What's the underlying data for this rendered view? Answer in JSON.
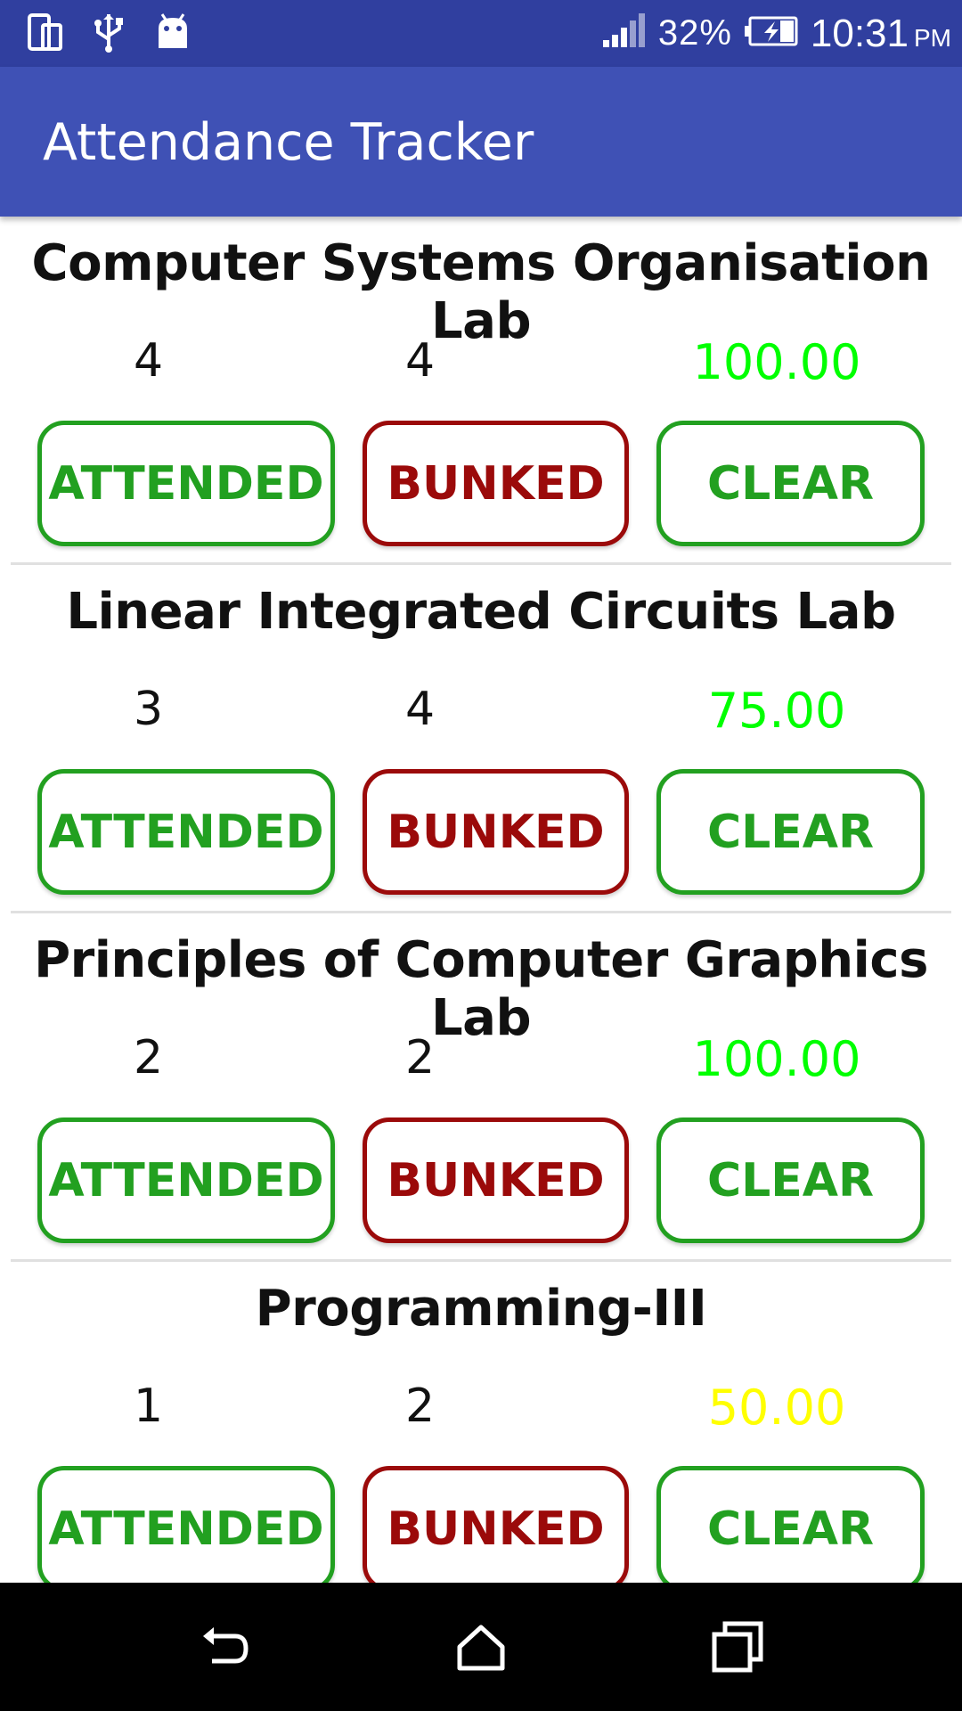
{
  "status_bar": {
    "battery_percent": "32%",
    "time": "10:31",
    "ampm": "PM",
    "icons": [
      "screen-rotation-icon",
      "usb-icon",
      "android-debug-icon",
      "signal-icon",
      "battery-charging-icon"
    ]
  },
  "app_bar": {
    "title": "Attendance Tracker"
  },
  "colors": {
    "primary": "#3f51b5",
    "primary_dark": "#303f9f",
    "attended_green": "#22a020",
    "bunked_red": "#9b0a0a",
    "pct_high": "#00ff00",
    "pct_mid": "#ffff00"
  },
  "subjects": [
    {
      "name": "Computer Systems Organisation Lab",
      "attended": "4",
      "total": "4",
      "percent": "100.00",
      "percent_color": "#00ff00",
      "attended_label": "ATTENDED",
      "bunked_label": "BUNKED",
      "clear_label": "CLEAR"
    },
    {
      "name": "Linear Integrated Circuits Lab",
      "attended": "3",
      "total": "4",
      "percent": "75.00",
      "percent_color": "#00ff00",
      "attended_label": "ATTENDED",
      "bunked_label": "BUNKED",
      "clear_label": "CLEAR"
    },
    {
      "name": "Principles of Computer Graphics Lab",
      "attended": "2",
      "total": "2",
      "percent": "100.00",
      "percent_color": "#00ff00",
      "attended_label": "ATTENDED",
      "bunked_label": "BUNKED",
      "clear_label": "CLEAR"
    },
    {
      "name": "Programming-III",
      "attended": "1",
      "total": "2",
      "percent": "50.00",
      "percent_color": "#ffff00",
      "attended_label": "ATTENDED",
      "bunked_label": "BUNKED",
      "clear_label": "CLEAR"
    }
  ],
  "nav_bar": {
    "buttons": [
      "back-icon",
      "home-icon",
      "recents-icon"
    ]
  }
}
